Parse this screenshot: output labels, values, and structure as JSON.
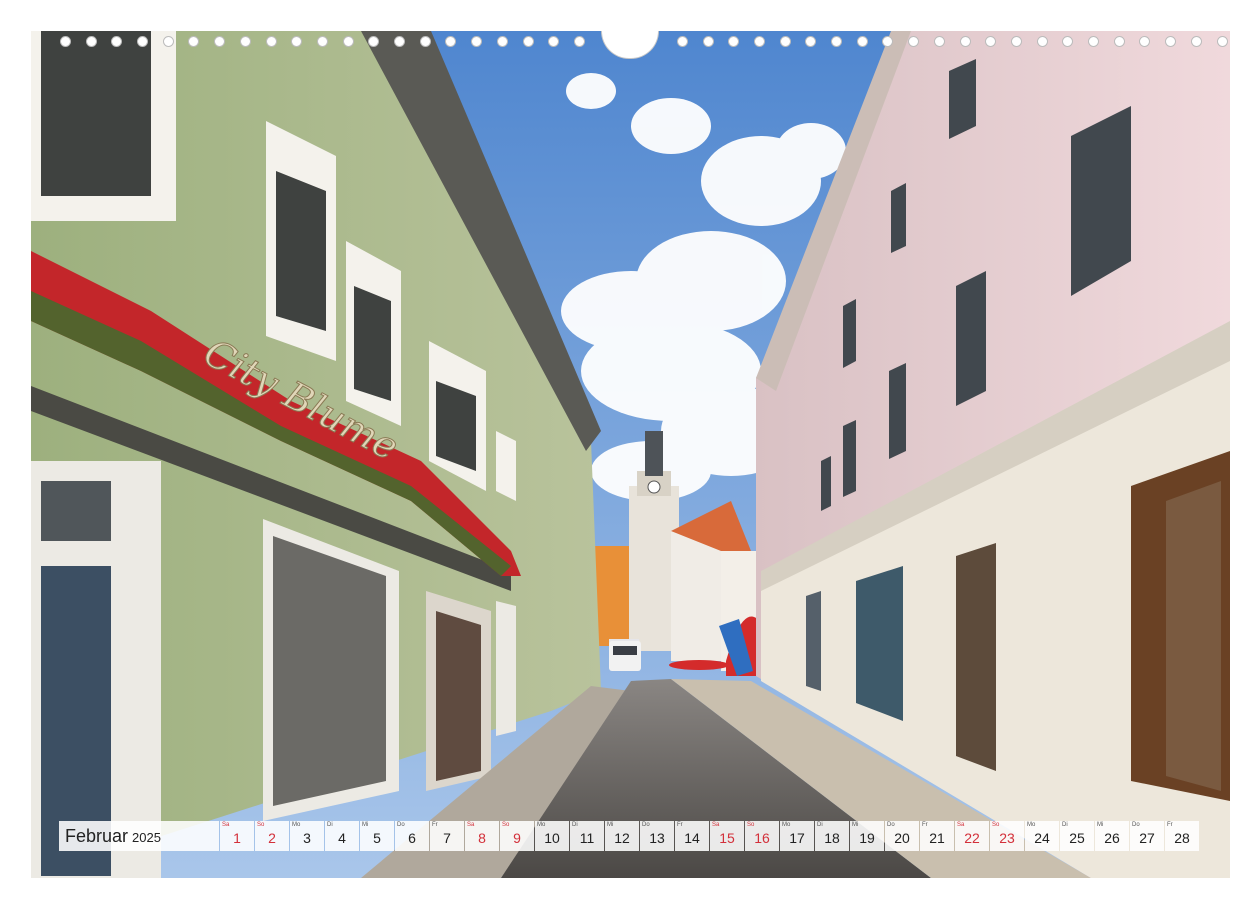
{
  "calendar": {
    "month": "Februar",
    "year": "2025",
    "days": [
      {
        "n": "1",
        "wd": "Sa",
        "weekend": true
      },
      {
        "n": "2",
        "wd": "So",
        "weekend": true
      },
      {
        "n": "3",
        "wd": "Mo",
        "weekend": false
      },
      {
        "n": "4",
        "wd": "Di",
        "weekend": false
      },
      {
        "n": "5",
        "wd": "Mi",
        "weekend": false
      },
      {
        "n": "6",
        "wd": "Do",
        "weekend": false
      },
      {
        "n": "7",
        "wd": "Fr",
        "weekend": false
      },
      {
        "n": "8",
        "wd": "Sa",
        "weekend": true
      },
      {
        "n": "9",
        "wd": "So",
        "weekend": true
      },
      {
        "n": "10",
        "wd": "Mo",
        "weekend": false
      },
      {
        "n": "11",
        "wd": "Di",
        "weekend": false
      },
      {
        "n": "12",
        "wd": "Mi",
        "weekend": false
      },
      {
        "n": "13",
        "wd": "Do",
        "weekend": false
      },
      {
        "n": "14",
        "wd": "Fr",
        "weekend": false
      },
      {
        "n": "15",
        "wd": "Sa",
        "weekend": true
      },
      {
        "n": "16",
        "wd": "So",
        "weekend": true
      },
      {
        "n": "17",
        "wd": "Mo",
        "weekend": false
      },
      {
        "n": "18",
        "wd": "Di",
        "weekend": false
      },
      {
        "n": "19",
        "wd": "Mi",
        "weekend": false
      },
      {
        "n": "20",
        "wd": "Do",
        "weekend": false
      },
      {
        "n": "21",
        "wd": "Fr",
        "weekend": false
      },
      {
        "n": "22",
        "wd": "Sa",
        "weekend": true
      },
      {
        "n": "23",
        "wd": "So",
        "weekend": true
      },
      {
        "n": "24",
        "wd": "Mo",
        "weekend": false
      },
      {
        "n": "25",
        "wd": "Di",
        "weekend": false
      },
      {
        "n": "26",
        "wd": "Mi",
        "weekend": false
      },
      {
        "n": "27",
        "wd": "Do",
        "weekend": false
      },
      {
        "n": "28",
        "wd": "Fr",
        "weekend": false
      }
    ]
  },
  "photo": {
    "shop_sign": "City Blume"
  },
  "colors": {
    "weekend": "#d3303a",
    "sky": "#7aa3d8",
    "green_facade": "#97a97a",
    "pink_facade": "#ecd3d6"
  }
}
